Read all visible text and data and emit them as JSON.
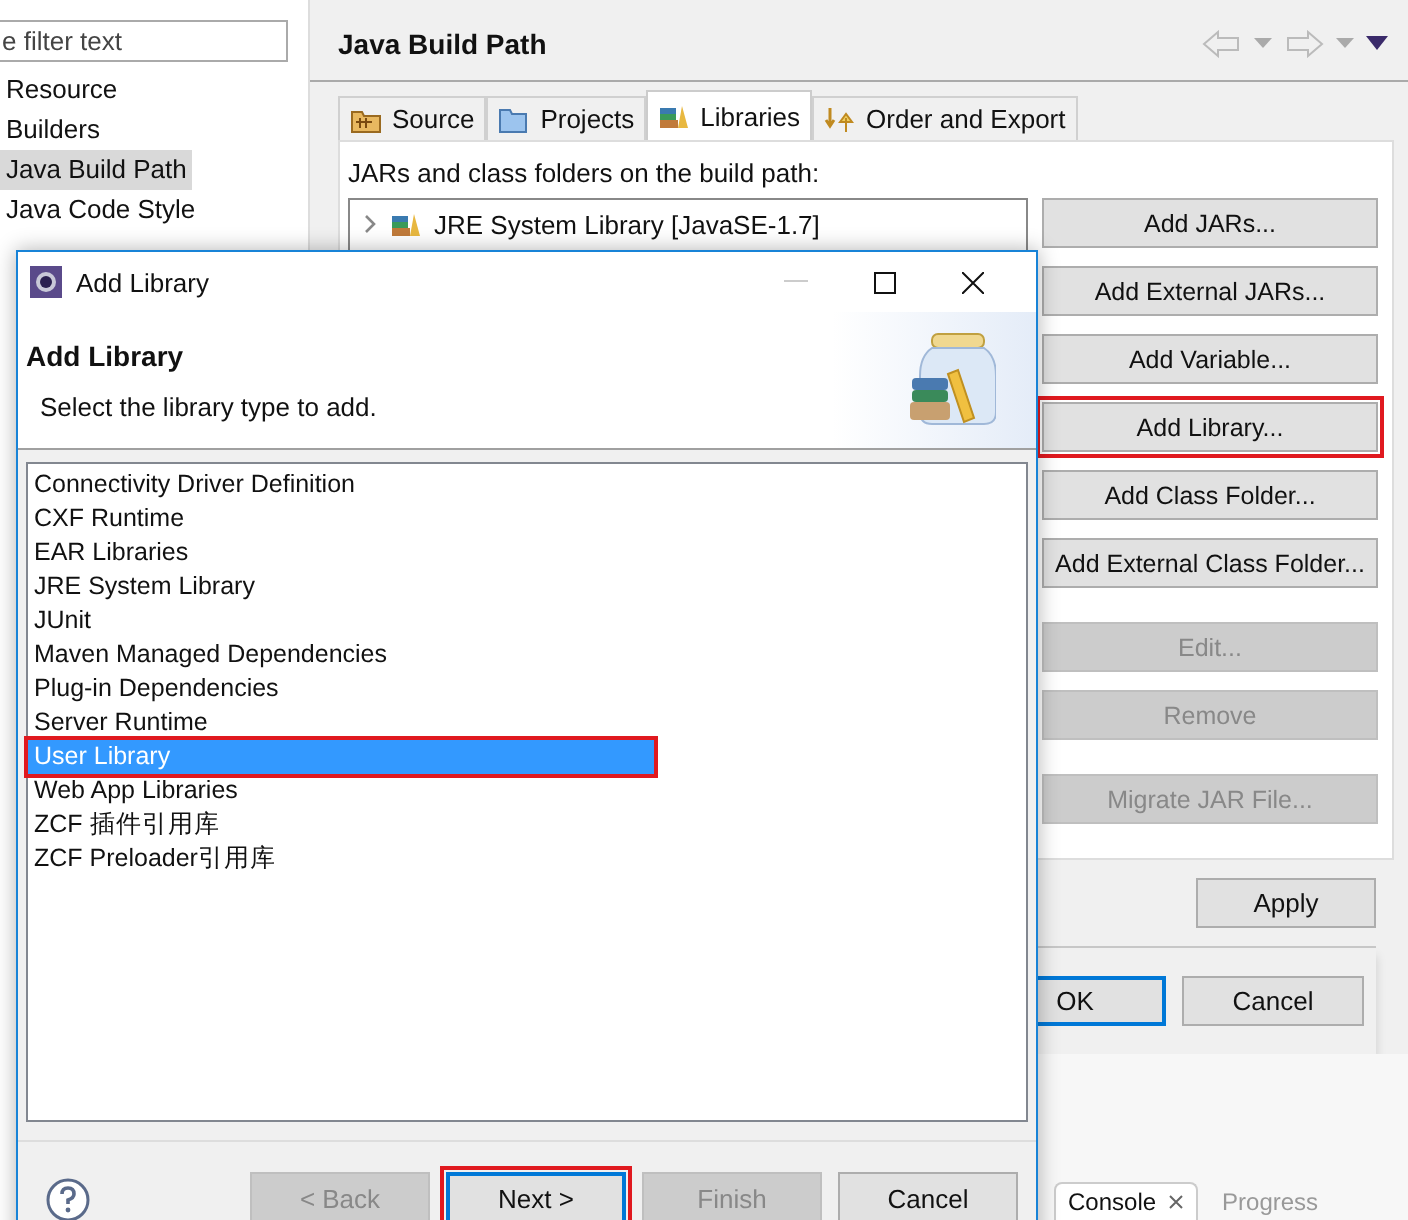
{
  "filter": {
    "placeholder": "e filter text"
  },
  "nav_items": [
    {
      "label": "Resource",
      "selected": false
    },
    {
      "label": "Builders",
      "selected": false
    },
    {
      "label": "Java Build Path",
      "selected": true
    },
    {
      "label": "Java Code Style",
      "selected": false
    }
  ],
  "page": {
    "title": "Java Build Path",
    "tabs": [
      {
        "label": "Source",
        "selected": false
      },
      {
        "label": "Projects",
        "selected": false
      },
      {
        "label": "Libraries",
        "selected": true
      },
      {
        "label": "Order and Export",
        "selected": false
      }
    ],
    "build_path_label": "JARs and class folders on the build path:",
    "entries": [
      {
        "label": "JRE System Library [JavaSE-1.7]",
        "expanded": false
      }
    ],
    "button_groups": [
      [
        {
          "label": "Add JARs...",
          "disabled": false,
          "highlighted": false
        },
        {
          "label": "Add External JARs...",
          "disabled": false,
          "highlighted": false
        },
        {
          "label": "Add Variable...",
          "disabled": false,
          "highlighted": false
        },
        {
          "label": "Add Library...",
          "disabled": false,
          "highlighted": true
        },
        {
          "label": "Add Class Folder...",
          "disabled": false,
          "highlighted": false
        },
        {
          "label": "Add External Class Folder...",
          "disabled": false,
          "highlighted": false
        }
      ],
      [
        {
          "label": "Edit...",
          "disabled": true,
          "highlighted": false
        },
        {
          "label": "Remove",
          "disabled": true,
          "highlighted": false
        }
      ],
      [
        {
          "label": "Migrate JAR File...",
          "disabled": true,
          "highlighted": false
        }
      ]
    ],
    "apply": "Apply"
  },
  "dialog_buttons": [
    {
      "label": "OK",
      "default": true
    },
    {
      "label": "Cancel",
      "default": false
    }
  ],
  "views": [
    {
      "label": "Console",
      "active": true,
      "closable": true
    },
    {
      "label": "Progress",
      "active": false,
      "closable": false
    }
  ],
  "add_library": {
    "title": "Add Library",
    "heading": "Add Library",
    "description": "Select the library type to add.",
    "library_types": [
      {
        "label": "Connectivity Driver Definition",
        "selected": false,
        "highlighted": false
      },
      {
        "label": "CXF Runtime",
        "selected": false,
        "highlighted": false
      },
      {
        "label": "EAR Libraries",
        "selected": false,
        "highlighted": false
      },
      {
        "label": "JRE System Library",
        "selected": false,
        "highlighted": false
      },
      {
        "label": "JUnit",
        "selected": false,
        "highlighted": false
      },
      {
        "label": "Maven Managed Dependencies",
        "selected": false,
        "highlighted": false
      },
      {
        "label": "Plug-in Dependencies",
        "selected": false,
        "highlighted": false
      },
      {
        "label": "Server Runtime",
        "selected": false,
        "highlighted": false
      },
      {
        "label": "User Library",
        "selected": true,
        "highlighted": true
      },
      {
        "label": "Web App Libraries",
        "selected": false,
        "highlighted": false
      },
      {
        "label": "ZCF 插件引用库",
        "selected": false,
        "highlighted": false
      },
      {
        "label": "ZCF Preloader引用库",
        "selected": false,
        "highlighted": false
      }
    ],
    "buttons": [
      {
        "label": "< Back",
        "disabled": true,
        "default": false,
        "highlighted": false
      },
      {
        "label": "Next >",
        "disabled": false,
        "default": true,
        "highlighted": true
      },
      {
        "label": "Finish",
        "disabled": true,
        "default": false,
        "highlighted": false
      },
      {
        "label": "Cancel",
        "disabled": false,
        "default": false,
        "highlighted": false
      }
    ]
  }
}
